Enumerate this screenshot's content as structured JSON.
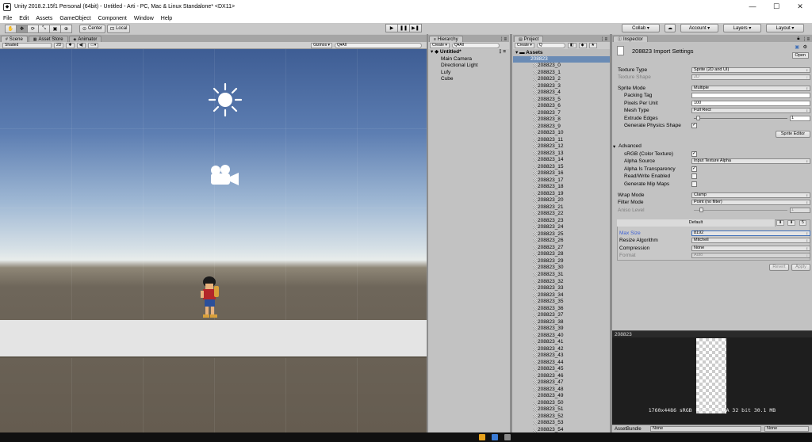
{
  "window": {
    "title": "Unity 2018.2.15f1 Personal (64bit) - Untitled - Arti - PC, Mac & Linux Standalone* <DX11>",
    "minimize": "—",
    "maximize": "☐",
    "close": "✕"
  },
  "menu": [
    "File",
    "Edit",
    "Assets",
    "GameObject",
    "Component",
    "Window",
    "Help"
  ],
  "toolbar": {
    "center_label": "Center",
    "local_label": "Local",
    "collab_label": "Collab ▾",
    "account_label": "Account ▾",
    "layers_label": "Layers ▾",
    "layout_label": "Layout ▾"
  },
  "scene_tabs": [
    {
      "label": "Scene",
      "icon": "scene-icon"
    },
    {
      "label": "Asset Store",
      "icon": "asset-store-icon"
    },
    {
      "label": "Animator",
      "icon": "animator-icon"
    }
  ],
  "scene_toolbar": {
    "shading_mode": "Shaded",
    "mode_2d": "2D",
    "gizmos_label": "Gizmos ▾",
    "search_placeholder": "Q▾All"
  },
  "hierarchy": {
    "tab_label": "Hierarchy",
    "create_label": "Create ▾",
    "search_placeholder": "Q▾All",
    "scene_name": "Untitled*",
    "items": [
      "Main Camera",
      "Directional Light",
      "Lufy",
      "Cube"
    ]
  },
  "project": {
    "tab_label": "Project",
    "create_label": "Create ▾",
    "root_label": "Assets",
    "folder_label": "208823",
    "items": [
      "208823_0",
      "208823_1",
      "208823_2",
      "208823_3",
      "208823_4",
      "208823_5",
      "208823_6",
      "208823_7",
      "208823_8",
      "208823_9",
      "208823_10",
      "208823_11",
      "208823_12",
      "208823_13",
      "208823_14",
      "208823_15",
      "208823_16",
      "208823_17",
      "208823_18",
      "208823_19",
      "208823_20",
      "208823_21",
      "208823_22",
      "208823_23",
      "208823_24",
      "208823_25",
      "208823_26",
      "208823_27",
      "208823_28",
      "208823_29",
      "208823_30",
      "208823_31",
      "208823_32",
      "208823_33",
      "208823_34",
      "208823_35",
      "208823_36",
      "208823_37",
      "208823_38",
      "208823_39",
      "208823_40",
      "208823_41",
      "208823_42",
      "208823_43",
      "208823_44",
      "208823_45",
      "208823_46",
      "208823_47",
      "208823_48",
      "208823_49",
      "208823_50",
      "208823_51",
      "208823_52",
      "208823_53",
      "208823_54"
    ]
  },
  "inspector": {
    "tab_label": "Inspector",
    "title": "208823 Import Settings",
    "open_label": "Open",
    "texture_type_label": "Texture Type",
    "texture_type_value": "Sprite (2D and UI)",
    "texture_shape_label": "Texture Shape",
    "texture_shape_value": "2D",
    "sprite_mode_label": "Sprite Mode",
    "sprite_mode_value": "Multiple",
    "packing_tag_label": "Packing Tag",
    "packing_tag_value": "",
    "ppu_label": "Pixels Per Unit",
    "ppu_value": "100",
    "mesh_type_label": "Mesh Type",
    "mesh_type_value": "Full Rect",
    "extrude_label": "Extrude Edges",
    "extrude_value": "1",
    "extrude_fraction": 0.03,
    "physics_shape_label": "Generate Physics Shape",
    "physics_shape_checked": true,
    "sprite_editor_label": "Sprite Editor",
    "advanced_label": "Advanced",
    "srgb_label": "sRGB (Color Texture)",
    "srgb_checked": true,
    "alpha_source_label": "Alpha Source",
    "alpha_source_value": "Input Texture Alpha",
    "alpha_transparency_label": "Alpha Is Transparency",
    "alpha_transparency_checked": true,
    "read_write_label": "Read/Write Enabled",
    "read_write_checked": false,
    "mipmaps_label": "Generate Mip Maps",
    "mipmaps_checked": false,
    "wrap_mode_label": "Wrap Mode",
    "wrap_mode_value": "Clamp",
    "filter_mode_label": "Filter Mode",
    "filter_mode_value": "Point (no filter)",
    "aniso_label": "Aniso Level",
    "aniso_value": "1",
    "aniso_fraction": 0.0625,
    "platform_tab_label": "Default",
    "max_size_label": "Max Size",
    "max_size_value": "8192",
    "resize_label": "Resize Algorithm",
    "resize_value": "Mitchell",
    "compression_label": "Compression",
    "compression_value": "None",
    "format_label": "Format",
    "format_value": "Auto",
    "revert_label": "Revert",
    "apply_label": "Apply"
  },
  "preview": {
    "header": "208823",
    "info": "1760x4486 sRGB (NPOT)  RGBA 32 bit  30.1 MB"
  },
  "asset_bundle": {
    "label": "AssetBundle",
    "name_value": "None",
    "variant_value": "None"
  },
  "colors": {
    "selection_blue": "#3e6eb7",
    "unity_panel": "#c2c2c2",
    "preview_bg": "#1e1e1e"
  }
}
